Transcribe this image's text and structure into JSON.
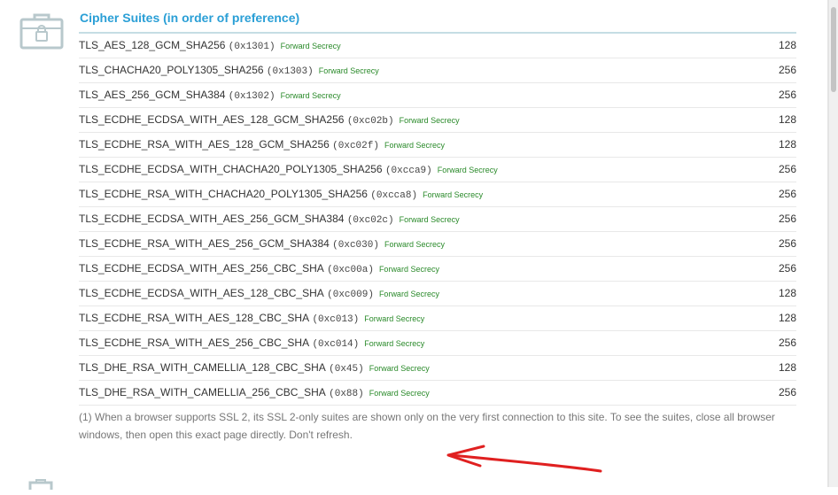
{
  "section": {
    "title": "Cipher Suites (in order of preference)",
    "icon": "locked-briefcase-icon"
  },
  "suites": [
    {
      "name": "TLS_AES_128_GCM_SHA256",
      "code": "(0x1301)",
      "tag": "Forward Secrecy",
      "bits": "128"
    },
    {
      "name": "TLS_CHACHA20_POLY1305_SHA256",
      "code": "(0x1303)",
      "tag": "Forward Secrecy",
      "bits": "256"
    },
    {
      "name": "TLS_AES_256_GCM_SHA384",
      "code": "(0x1302)",
      "tag": "Forward Secrecy",
      "bits": "256"
    },
    {
      "name": "TLS_ECDHE_ECDSA_WITH_AES_128_GCM_SHA256",
      "code": "(0xc02b)",
      "tag": "Forward Secrecy",
      "bits": "128"
    },
    {
      "name": "TLS_ECDHE_RSA_WITH_AES_128_GCM_SHA256",
      "code": "(0xc02f)",
      "tag": "Forward Secrecy",
      "bits": "128"
    },
    {
      "name": "TLS_ECDHE_ECDSA_WITH_CHACHA20_POLY1305_SHA256",
      "code": "(0xcca9)",
      "tag": "Forward Secrecy",
      "bits": "256"
    },
    {
      "name": "TLS_ECDHE_RSA_WITH_CHACHA20_POLY1305_SHA256",
      "code": "(0xcca8)",
      "tag": "Forward Secrecy",
      "bits": "256"
    },
    {
      "name": "TLS_ECDHE_ECDSA_WITH_AES_256_GCM_SHA384",
      "code": "(0xc02c)",
      "tag": "Forward Secrecy",
      "bits": "256"
    },
    {
      "name": "TLS_ECDHE_RSA_WITH_AES_256_GCM_SHA384",
      "code": "(0xc030)",
      "tag": "Forward Secrecy",
      "bits": "256"
    },
    {
      "name": "TLS_ECDHE_ECDSA_WITH_AES_256_CBC_SHA",
      "code": "(0xc00a)",
      "tag": "Forward Secrecy",
      "bits": "256"
    },
    {
      "name": "TLS_ECDHE_ECDSA_WITH_AES_128_CBC_SHA",
      "code": "(0xc009)",
      "tag": "Forward Secrecy",
      "bits": "128"
    },
    {
      "name": "TLS_ECDHE_RSA_WITH_AES_128_CBC_SHA",
      "code": "(0xc013)",
      "tag": "Forward Secrecy",
      "bits": "128"
    },
    {
      "name": "TLS_ECDHE_RSA_WITH_AES_256_CBC_SHA",
      "code": "(0xc014)",
      "tag": "Forward Secrecy",
      "bits": "256"
    },
    {
      "name": "TLS_DHE_RSA_WITH_CAMELLIA_128_CBC_SHA",
      "code": "(0x45)",
      "tag": "Forward Secrecy",
      "bits": "128"
    },
    {
      "name": "TLS_DHE_RSA_WITH_CAMELLIA_256_CBC_SHA",
      "code": "(0x88)",
      "tag": "Forward Secrecy",
      "bits": "256"
    }
  ],
  "footnote": "(1) When a browser supports SSL 2, its SSL 2-only suites are shown only on the very first connection to this site. To see the suites, close all browser windows, then open this exact page directly. Don't refresh.",
  "annotation": {
    "arrow_color": "#e02020"
  },
  "colors": {
    "accent": "#2a9fd6",
    "forward_secrecy": "#2a8a2a",
    "icon": "#b8c8cc"
  }
}
